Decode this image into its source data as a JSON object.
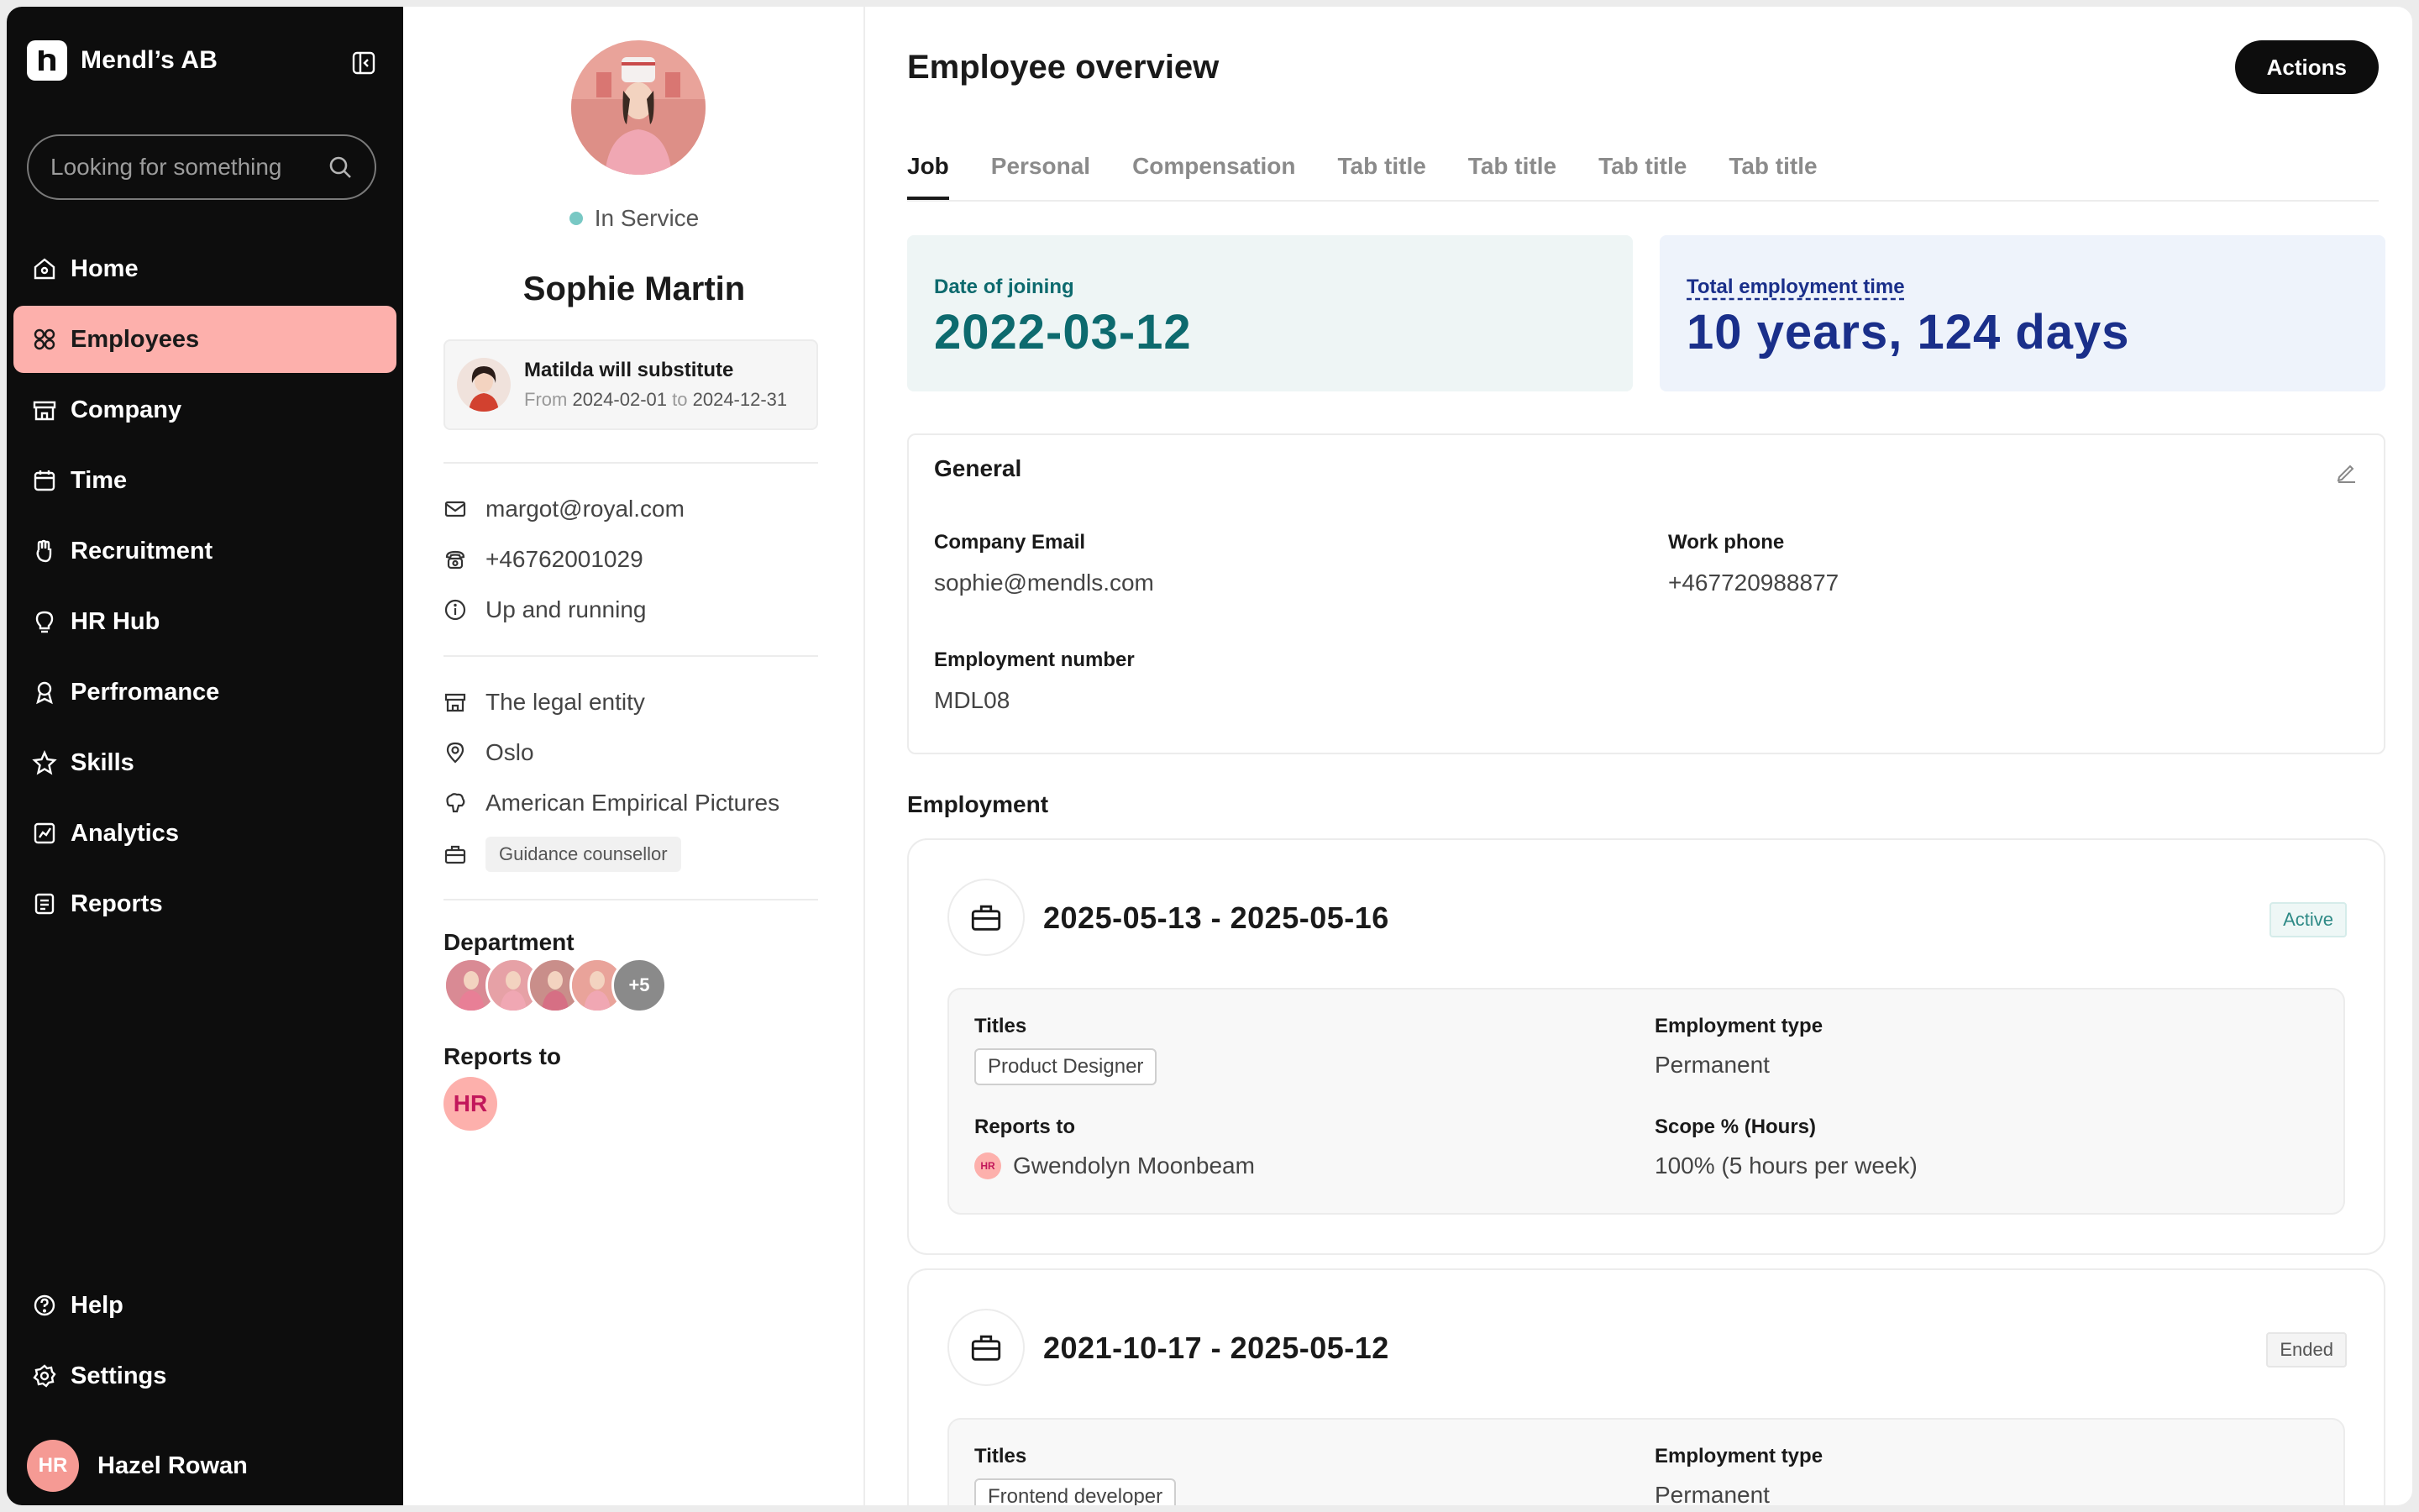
{
  "sidebar": {
    "company": "Mendl’s AB",
    "search_placeholder": "Looking for something",
    "nav": [
      {
        "label": "Home",
        "icon": "home-icon"
      },
      {
        "label": "Employees",
        "icon": "employees-icon",
        "active": true
      },
      {
        "label": "Company",
        "icon": "company-icon"
      },
      {
        "label": "Time",
        "icon": "calendar-icon"
      },
      {
        "label": "Recruitment",
        "icon": "recruitment-icon"
      },
      {
        "label": "HR Hub",
        "icon": "lightbulb-icon"
      },
      {
        "label": "Perfromance",
        "icon": "award-icon"
      },
      {
        "label": "Skills",
        "icon": "star-icon"
      },
      {
        "label": "Analytics",
        "icon": "chart-icon"
      },
      {
        "label": "Reports",
        "icon": "reports-icon"
      }
    ],
    "bottom": [
      {
        "label": "Help",
        "icon": "help-icon"
      },
      {
        "label": "Settings",
        "icon": "settings-icon"
      }
    ],
    "user": {
      "initials": "HR",
      "name": "Hazel Rowan"
    }
  },
  "profile": {
    "status": "In Service",
    "name": "Sophie Martin",
    "substitute": {
      "title": "Matilda will substitute",
      "from_label": "From",
      "from": "2024-02-01",
      "to_label": "to",
      "to": "2024-12-31"
    },
    "contact": [
      {
        "icon": "mail-icon",
        "text": "margot@royal.com"
      },
      {
        "icon": "phone-icon",
        "text": "+46762001029"
      },
      {
        "icon": "info-icon",
        "text": "Up and running"
      }
    ],
    "org": [
      {
        "icon": "building-icon",
        "text": "The legal entity"
      },
      {
        "icon": "location-icon",
        "text": "Oslo"
      },
      {
        "icon": "org-icon",
        "text": "American Empirical Pictures"
      }
    ],
    "role_tag": "Guidance counsellor",
    "department_label": "Department",
    "department_more": "+5",
    "reports_to_label": "Reports to",
    "reports_to_initials": "HR"
  },
  "main": {
    "title": "Employee overview",
    "actions_label": "Actions",
    "tabs": [
      "Job",
      "Personal",
      "Compensation",
      "Tab title",
      "Tab title",
      "Tab title",
      "Tab title"
    ],
    "stats": {
      "joining_label": "Date of joining",
      "joining_value": "2022-03-12",
      "total_label": "Total employment time",
      "total_value": "10 years, 124 days"
    },
    "general": {
      "title": "General",
      "company_email_label": "Company Email",
      "company_email": "sophie@mendls.com",
      "work_phone_label": "Work phone",
      "work_phone": "+467720988877",
      "employment_number_label": "Employment number",
      "employment_number": "MDL08"
    },
    "employment_heading": "Employment",
    "employments": [
      {
        "range": "2025-05-13 - 2025-05-16",
        "status": "Active",
        "titles_label": "Titles",
        "title": "Product Designer",
        "type_label": "Employment type",
        "type": "Permanent",
        "reports_label": "Reports to",
        "reports_initials": "HR",
        "reports_name": "Gwendolyn Moonbeam",
        "scope_label": "Scope % (Hours)",
        "scope": "100% (5 hours per week)"
      },
      {
        "range": "2021-10-17 - 2025-05-12",
        "status": "Ended",
        "titles_label": "Titles",
        "title": "Frontend developer",
        "type_label": "Employment type",
        "type": "Permanent"
      }
    ]
  },
  "colors": {
    "sidebar_bg": "#0d0d0d",
    "active_nav": "#fdb0ac",
    "teal": "#0d6a6e",
    "navy": "#1a2f8a"
  }
}
